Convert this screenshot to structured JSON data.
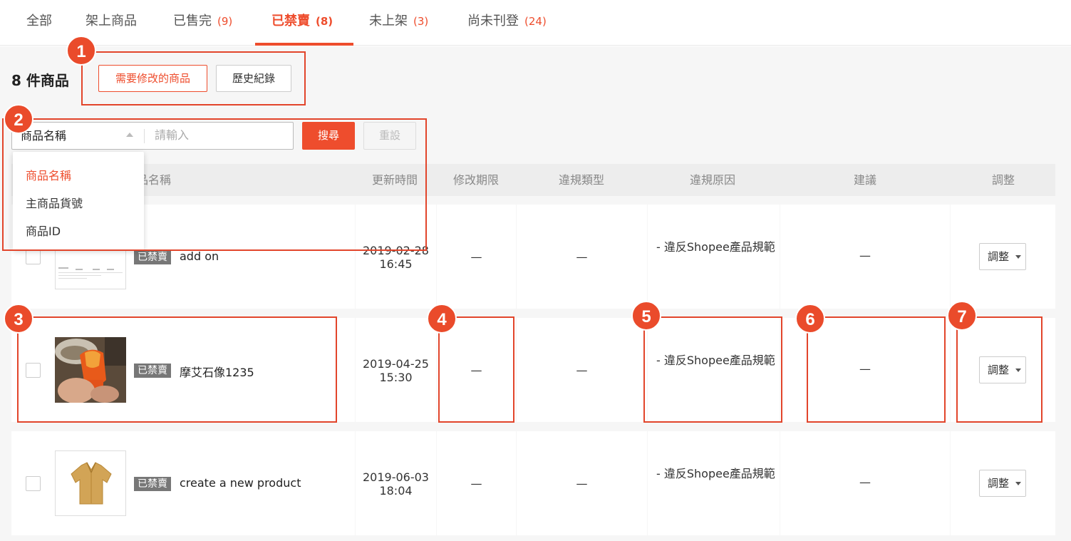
{
  "tabs": [
    {
      "label": "全部",
      "count": ""
    },
    {
      "label": "架上商品",
      "count": ""
    },
    {
      "label": "已售完",
      "count": "(9)"
    },
    {
      "label": "已禁賣",
      "count": "(8)"
    },
    {
      "label": "未上架",
      "count": "(3)"
    },
    {
      "label": "尚未刊登",
      "count": "(24)"
    }
  ],
  "active_tab": "已禁賣",
  "product_count_title": "8 件商品",
  "filter_buttons": {
    "need_edit": "需要修改的商品",
    "history": "歷史紀錄"
  },
  "search": {
    "type_selected": "商品名稱",
    "placeholder": "請輸入",
    "search_label": "搜尋",
    "reset_label": "重設",
    "options": [
      "商品名稱",
      "主商品貨號",
      "商品ID"
    ]
  },
  "table": {
    "headers": {
      "name": "商品名稱",
      "updated": "更新時間",
      "deadline": "修改期限",
      "type": "違規類型",
      "reason": "違規原因",
      "suggestion": "建議",
      "adjust": "調整"
    },
    "rows": [
      {
        "badge": "已禁賣",
        "name": "add on",
        "updated": "2019-02-28\n16:45",
        "deadline": "—",
        "type": "—",
        "reason": "- 違反Shopee產品規範",
        "suggestion": "—",
        "adjust": "調整"
      },
      {
        "badge": "已禁賣",
        "name": "摩艾石像1235",
        "updated": "2019-04-25\n15:30",
        "deadline": "—",
        "type": "—",
        "reason": "- 違反Shopee產品規範",
        "suggestion": "—",
        "adjust": "調整"
      },
      {
        "badge": "已禁賣",
        "name": "create a new product",
        "updated": "2019-06-03\n18:04",
        "deadline": "—",
        "type": "—",
        "reason": "- 違反Shopee產品規範",
        "suggestion": "—",
        "adjust": "調整"
      }
    ]
  },
  "annotations": [
    "1",
    "2",
    "3",
    "4",
    "5",
    "6",
    "7"
  ],
  "colors": {
    "accent": "#ee4d2d",
    "annotation": "#e2452b",
    "badge": "#777777"
  }
}
